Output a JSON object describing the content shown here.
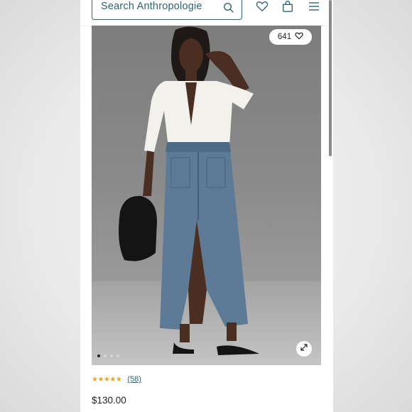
{
  "search": {
    "placeholder": "Search Anthropologie"
  },
  "header": {
    "icons": [
      "search-icon",
      "heart-icon",
      "bag-icon",
      "menu-icon"
    ]
  },
  "gallery": {
    "like_count": "641",
    "slide_count": 4,
    "active_slide": 1
  },
  "product": {
    "rating_stars": "★★★★★",
    "rating_value": 4.5,
    "review_count": "(58)",
    "price": "$130.00"
  },
  "colors": {
    "accent": "#2f6473",
    "star": "#e5a823"
  }
}
